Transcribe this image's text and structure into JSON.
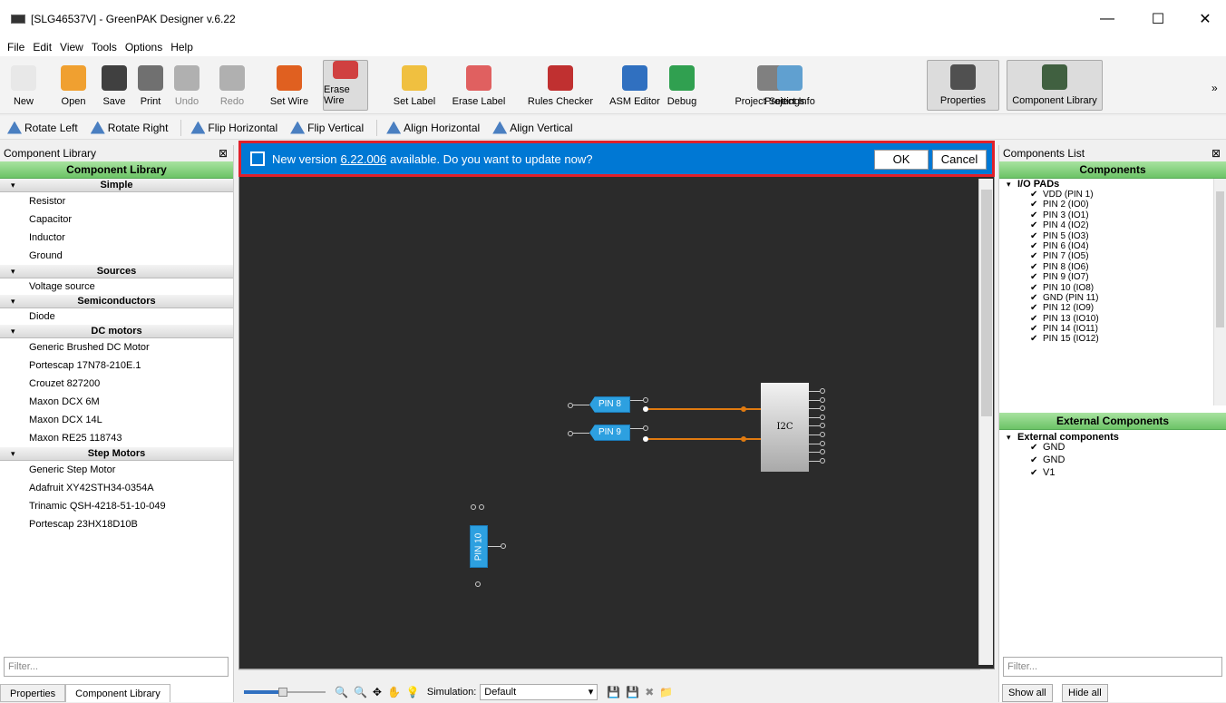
{
  "window": {
    "title": "[SLG46537V] - GreenPAK Designer v.6.22"
  },
  "menu": [
    "File",
    "Edit",
    "View",
    "Tools",
    "Options",
    "Help"
  ],
  "toolbar": [
    {
      "label": "New",
      "color": "#e8e8e8",
      "state": "normal"
    },
    {
      "label": "Open",
      "color": "#f0a030",
      "state": "normal"
    },
    {
      "label": "Save",
      "color": "#404040",
      "state": "normal"
    },
    {
      "label": "Print",
      "color": "#707070",
      "state": "normal"
    },
    {
      "label": "Undo",
      "color": "#b0b0b0",
      "state": "disabled"
    },
    {
      "label": "Redo",
      "color": "#b0b0b0",
      "state": "disabled"
    },
    {
      "label": "Set Wire",
      "color": "#e06020",
      "state": "normal"
    },
    {
      "label": "Erase Wire",
      "color": "#d04040",
      "state": "active"
    },
    {
      "label": "Set Label",
      "color": "#f0c040",
      "state": "normal"
    },
    {
      "label": "Erase Label",
      "color": "#e06060",
      "state": "normal"
    },
    {
      "label": "Rules Checker",
      "color": "#c03030",
      "state": "normal"
    },
    {
      "label": "ASM Editor",
      "color": "#3070c0",
      "state": "normal"
    },
    {
      "label": "Debug",
      "color": "#30a050",
      "state": "normal"
    },
    {
      "label": "Project Settings",
      "color": "#808080",
      "state": "normal"
    },
    {
      "label": "Project Info",
      "color": "#60a0d0",
      "state": "normal"
    },
    {
      "label": "Properties",
      "color": "#505050",
      "state": "active"
    },
    {
      "label": "Component Library",
      "color": "#406040",
      "state": "active"
    }
  ],
  "toolbar2": [
    "Rotate Left",
    "Rotate Right",
    "Flip Horizontal",
    "Flip Vertical",
    "Align Horizontal",
    "Align Vertical"
  ],
  "left_panel": {
    "title": "Component Library",
    "header": "Component Library",
    "categories": [
      {
        "name": "Simple",
        "items": [
          "Resistor",
          "Capacitor",
          "Inductor",
          "Ground"
        ]
      },
      {
        "name": "Sources",
        "items": [
          "Voltage source"
        ]
      },
      {
        "name": "Semiconductors",
        "items": [
          "Diode"
        ]
      },
      {
        "name": "DC motors",
        "items": [
          "Generic Brushed DC Motor",
          "Portescap 17N78-210E.1",
          "Crouzet 827200",
          "Maxon DCX 6M",
          "Maxon DCX 14L",
          "Maxon RE25 118743"
        ]
      },
      {
        "name": "Step Motors",
        "items": [
          "Generic Step Motor",
          "Adafruit XY42STH34-0354A",
          "Trinamic QSH-4218-51-10-049",
          "Portescap 23HX18D10B"
        ]
      }
    ],
    "filter_placeholder": "Filter...",
    "tabs": [
      "Properties",
      "Component Library"
    ]
  },
  "notice": {
    "text_before": "New version",
    "version": "6.22.006",
    "text_after": "available. Do you want to update now?",
    "ok": "OK",
    "cancel": "Cancel"
  },
  "canvas": {
    "pins": [
      "PIN 8",
      "PIN 9",
      "PIN 10"
    ],
    "block": "I2C"
  },
  "bottom": {
    "simulation_label": "Simulation:",
    "simulation_value": "Default"
  },
  "right_panel": {
    "title": "Components List",
    "header": "Components",
    "group": "I/O PADs",
    "items": [
      "VDD (PIN 1)",
      "PIN 2 (IO0)",
      "PIN 3 (IO1)",
      "PIN 4 (IO2)",
      "PIN 5 (IO3)",
      "PIN 6 (IO4)",
      "PIN 7 (IO5)",
      "PIN 8 (IO6)",
      "PIN 9 (IO7)",
      "PIN 10 (IO8)",
      "GND (PIN 11)",
      "PIN 12 (IO9)",
      "PIN 13 (IO10)",
      "PIN 14 (IO11)",
      "PIN 15 (IO12)"
    ],
    "ext_header": "External Components",
    "ext_group": "External components",
    "ext_items": [
      "GND",
      "GND",
      "V1"
    ],
    "filter_placeholder": "Filter...",
    "show_all": "Show all",
    "hide_all": "Hide all"
  }
}
